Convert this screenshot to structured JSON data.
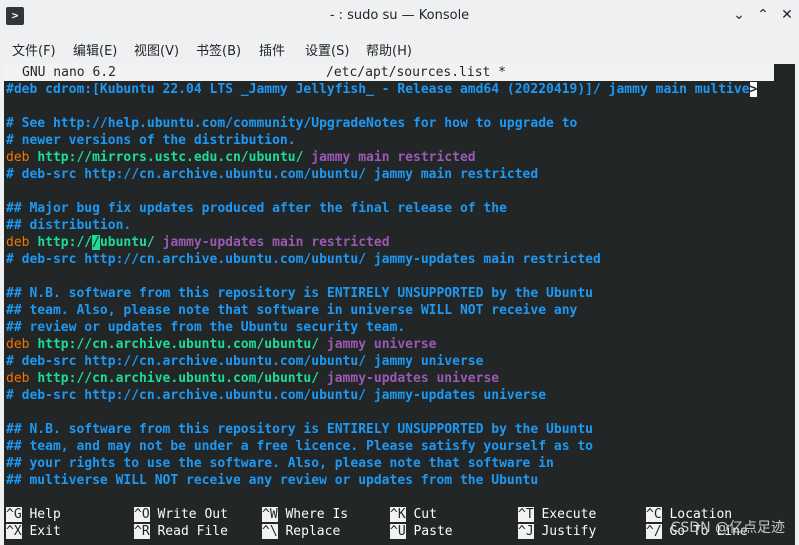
{
  "window": {
    "title": "- : sudo su — Konsole",
    "app_icon_glyph": ">",
    "minimize_glyph": "⌄",
    "maximize_glyph": "⌃",
    "close_glyph": "✕"
  },
  "menu": [
    "文件(F)",
    "编辑(E)",
    "视图(V)",
    "书签(B)",
    "插件",
    "设置(S)",
    "帮助(H)"
  ],
  "nano": {
    "version": "GNU nano 6.2",
    "filename": "/etc/apt/sources.list *"
  },
  "lines": {
    "l1": "#deb cdrom:[Kubuntu 22.04 LTS _Jammy Jellyfish_ - Release amd64 (20220419)]/ jammy main multive",
    "l1_more": ">",
    "l3": "# See http://help.ubuntu.com/community/UpgradeNotes for how to upgrade to",
    "l4": "# newer versions of the distribution.",
    "l5_deb": "deb",
    "l5_url": "http://mirrors.ustc.edu.cn/ubuntu/",
    "l5_dist": "jammy main restricted",
    "l6": "# deb-src http://cn.archive.ubuntu.com/ubuntu/ jammy main restricted",
    "l8": "## Major bug fix updates produced after the final release of the",
    "l9": "## distribution.",
    "l10_deb": "deb",
    "l10_url_a": "http://",
    "l10_cursor": "/",
    "l10_url_b": "ubuntu/",
    "l10_dist": "jammy-updates main restricted",
    "l11": "# deb-src http://cn.archive.ubuntu.com/ubuntu/ jammy-updates main restricted",
    "l13": "## N.B. software from this repository is ENTIRELY UNSUPPORTED by the Ubuntu",
    "l14": "## team. Also, please note that software in universe WILL NOT receive any",
    "l15": "## review or updates from the Ubuntu security team.",
    "l16_deb": "deb",
    "l16_url": "http://cn.archive.ubuntu.com/ubuntu/",
    "l16_dist": "jammy universe",
    "l17": "# deb-src http://cn.archive.ubuntu.com/ubuntu/ jammy universe",
    "l18_deb": "deb",
    "l18_url": "http://cn.archive.ubuntu.com/ubuntu/",
    "l18_dist": "jammy-updates universe",
    "l19": "# deb-src http://cn.archive.ubuntu.com/ubuntu/ jammy-updates universe",
    "l21": "## N.B. software from this repository is ENTIRELY UNSUPPORTED by the Ubuntu",
    "l22": "## team, and may not be under a free licence. Please satisfy yourself as to",
    "l23": "## your rights to use the software. Also, please note that software in",
    "l24": "## multiverse WILL NOT receive any review or updates from the Ubuntu"
  },
  "shortcuts": [
    {
      "key": "^G",
      "label": "Help"
    },
    {
      "key": "^O",
      "label": "Write Out"
    },
    {
      "key": "^W",
      "label": "Where Is"
    },
    {
      "key": "^K",
      "label": "Cut"
    },
    {
      "key": "^T",
      "label": "Execute"
    },
    {
      "key": "^C",
      "label": "Location"
    },
    {
      "key": "^X",
      "label": "Exit"
    },
    {
      "key": "^R",
      "label": "Read File"
    },
    {
      "key": "^\\",
      "label": "Replace"
    },
    {
      "key": "^U",
      "label": "Paste"
    },
    {
      "key": "^J",
      "label": "Justify"
    },
    {
      "key": "^/",
      "label": "Go To Line"
    }
  ],
  "watermark": "CSDN @亿点足迹",
  "colors": {
    "comment": "#1d99f3",
    "deb_keyword": "#f67400",
    "url": "#1cdc9a",
    "distribution": "#9b59b6",
    "terminal_bg": "#232627"
  }
}
